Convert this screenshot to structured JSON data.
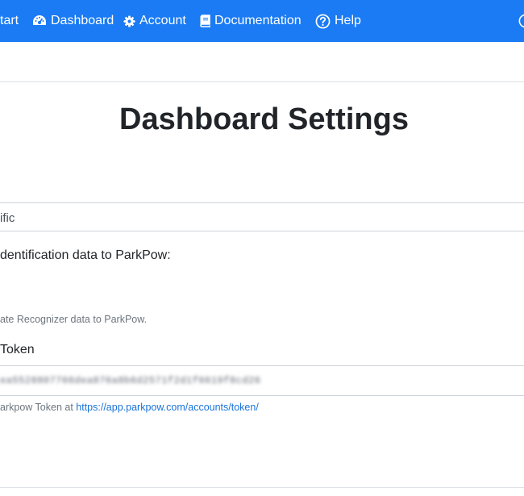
{
  "navbar": {
    "background": "#1a7bf4",
    "items": [
      {
        "label": "tart",
        "icon": "none"
      },
      {
        "label": "Dashboard",
        "icon": "dashboard-gauge-icon"
      },
      {
        "label": "Account",
        "icon": "gear-icon"
      },
      {
        "label": "Documentation",
        "icon": "book-icon"
      },
      {
        "label": "Help",
        "icon": "question-circle-icon"
      }
    ]
  },
  "page": {
    "title": "Dashboard Settings"
  },
  "form": {
    "top_field_value": "ific",
    "parkpow_label": "dentification data to ParkPow:",
    "parkpow_help": "ate Recognizer data to ParkPow.",
    "token_label": "Token",
    "token_value": "ea5528807766dea876a8b6d2571f2d1f6619f8cd26",
    "token_help_prefix": "arkpow Token at ",
    "token_help_link": "https://app.parkpow.com/accounts/token/"
  }
}
